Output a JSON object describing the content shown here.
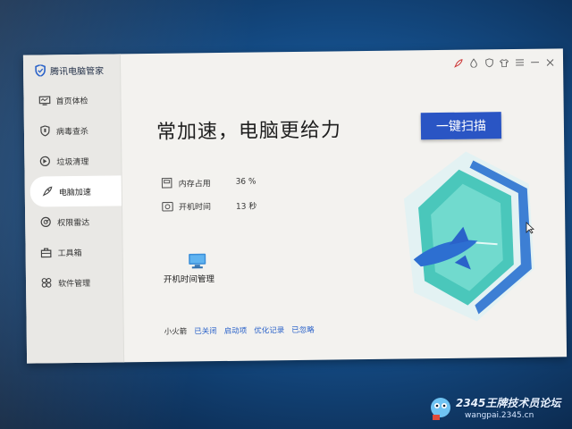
{
  "app": {
    "name": "腾讯电脑管家"
  },
  "sidebar": {
    "items": [
      {
        "label": "首页体检",
        "icon": "monitor-check-icon"
      },
      {
        "label": "病毒查杀",
        "icon": "shield-scan-icon"
      },
      {
        "label": "垃圾清理",
        "icon": "trash-icon"
      },
      {
        "label": "电脑加速",
        "icon": "rocket-icon",
        "active": true
      },
      {
        "label": "权限雷达",
        "icon": "radar-icon"
      },
      {
        "label": "工具箱",
        "icon": "toolbox-icon"
      },
      {
        "label": "软件管理",
        "icon": "apps-icon"
      }
    ]
  },
  "main": {
    "title": "常加速，电脑更给力",
    "scan_button": "一键扫描",
    "stats": [
      {
        "label": "内存占用",
        "value": "36 %",
        "icon": "memory-icon"
      },
      {
        "label": "开机时间",
        "value": "13 秒",
        "icon": "clock-icon"
      }
    ],
    "boot_tool": {
      "label": "开机时间管理",
      "icon": "monitor-icon"
    },
    "links": {
      "plain": "小火箭",
      "items": [
        "已关闭",
        "启动项",
        "优化记录",
        "已忽略"
      ]
    }
  },
  "titlebar": {
    "icons": [
      "rocket-mini-icon",
      "droplet-icon",
      "shield-mini-icon",
      "shirt-icon",
      "menu-icon",
      "minimize-icon",
      "close-icon"
    ]
  },
  "watermark": {
    "text": "2345王牌技术员论坛",
    "url": "wangpai.2345.cn"
  },
  "colors": {
    "accent": "#2a55c4",
    "link": "#2a62c9",
    "desktop": "#144c86",
    "art_teal": "#2fc0b0",
    "art_blue": "#3d7fd4"
  }
}
